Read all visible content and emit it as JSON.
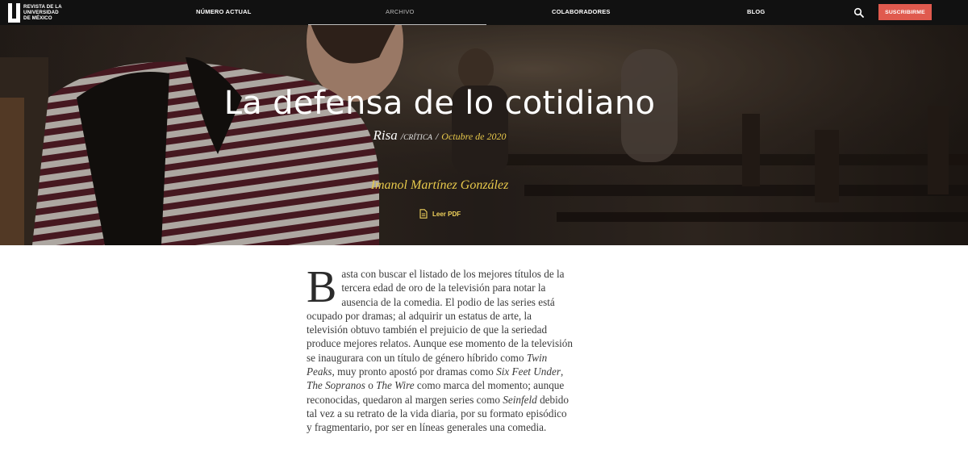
{
  "header": {
    "logo_text": "REVISTA DE LA\nUNIVERSIDAD\nDE MÉXICO",
    "nav": [
      {
        "label": "NÚMERO ACTUAL",
        "active": false
      },
      {
        "label": "ARCHIVO",
        "active": true
      },
      {
        "label": "COLABORADORES",
        "active": false
      },
      {
        "label": "BLOG",
        "active": false
      }
    ],
    "search_icon": "search-icon",
    "subscribe_label": "SUSCRIBIRME"
  },
  "hero": {
    "title": "La defensa de lo cotidiano",
    "section": "Risa",
    "separator": "/",
    "type": "crítica",
    "date": "Octubre de 2020",
    "author": "Imanol Martínez González",
    "pdf_label": "Leer PDF",
    "pdf_icon": "document-icon"
  },
  "article": {
    "dropcap": "B",
    "p1_a": "asta con buscar el listado de los mejores títulos de la tercera edad de oro de la televisión para notar la ausencia de la comedia. El podio de las series está ocupado por dramas; al adquirir un estatus de arte, la televisión obtuvo también el prejuicio de que la seriedad produce mejores relatos. Aunque ese momento de la televisión se inaugurara con un título de género híbrido como ",
    "t1": "Twin Peaks",
    "p1_b": ", muy pronto apostó por dramas como ",
    "t2": "Six Feet Under",
    "p1_c": ", ",
    "t3": "The Sopranos",
    "p1_d": " o ",
    "t4": "The Wire",
    "p1_e": " como marca del momento; aunque reconocidas, quedaron al margen series como ",
    "t5": "Seinfeld",
    "p1_f": " debido tal vez a su retrato de la vida diaria, por su formato episódico y fragmentario, por ser en líneas generales una comedia."
  },
  "colors": {
    "topbar": "#111111",
    "subscribe": "#e05a4e",
    "accent_gold": "#e8c94b",
    "body_text": "#3a3a3a"
  }
}
